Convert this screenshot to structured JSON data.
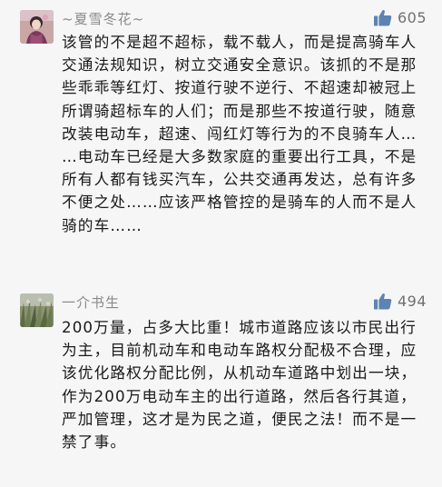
{
  "comments": [
    {
      "nickname": "~夏雪冬花~",
      "likes": "605",
      "like_icon": "thumbs-up-icon",
      "text": "该管的不是超不超标，载不载人，而是提高骑车人交通法规知识，树立交通安全意识。该抓的不是那些乖乖等红灯、按道行驶不逆行、不超速却被冠上所谓骑超标车的人们；而是那些不按道行驶，随意改装电动车，超速、闯红灯等行为的不良骑车人……电动车已经是大多数家庭的重要出行工具，不是所有人都有钱买汽车，公共交通再发达，总有许多不便之处……应该严格管控的是骑车的人而不是人骑的车……"
    },
    {
      "nickname": "一介书生",
      "likes": "494",
      "like_icon": "thumbs-up-icon",
      "text": "200万量，占多大比重！城市道路应该以市民出行为主，目前机动车和电动车路权分配极不合理，应该优化路权分配比例，从机动车道路中划出一块，作为200万电动车主的出行道路，然后各行其道，严加管理，这才是为民之道，便民之法！而不是一禁了事。"
    }
  ],
  "colors": {
    "background": "#f6f6f6",
    "nickname": "#8a8a8a",
    "text": "#1a1a1a",
    "like_icon": "#5d84b0",
    "like_count": "#707070"
  }
}
